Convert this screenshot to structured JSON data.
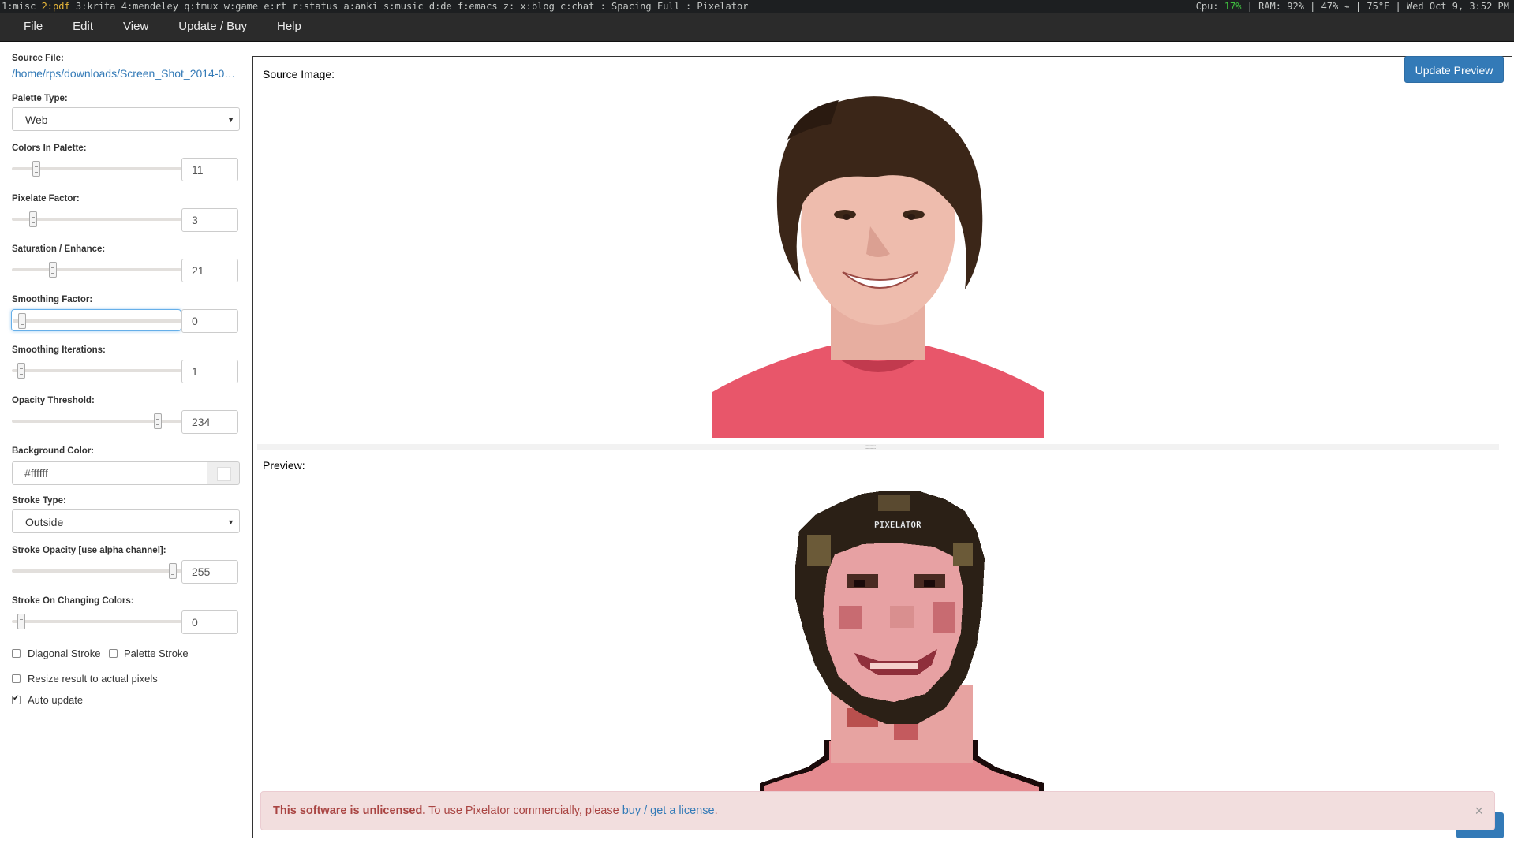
{
  "statusbar": {
    "ws_before": "1:misc ",
    "ws_active": "2:pdf",
    "ws_after": " 3:krita 4:mendeley q:tmux w:game e:rt r:status a:anki s:music d:de f:emacs z: x:blog c:chat : Spacing Full : Pixelator",
    "cpu_label": "Cpu: ",
    "cpu_value": "17%",
    "rest": " | RAM: 92% | 47% ⌁ | 75°F | Wed Oct  9,  3:52 PM"
  },
  "menu": {
    "items": [
      "File",
      "Edit",
      "View",
      "Update / Buy",
      "Help"
    ]
  },
  "sidebar": {
    "source_file_label": "Source File:",
    "source_file_path": "/home/rps/downloads/Screen_Shot_2014-05-…",
    "palette_type_label": "Palette Type:",
    "palette_type_value": "Web",
    "colors_label": "Colors In Palette:",
    "colors_value": "11",
    "colors_level": 0.1,
    "pixelate_label": "Pixelate Factor:",
    "pixelate_value": "3",
    "pixelate_level": 0.08,
    "saturation_label": "Saturation / Enhance:",
    "saturation_value": "21",
    "saturation_level": 0.21,
    "smoothing_label": "Smoothing Factor:",
    "smoothing_value": "0",
    "smoothing_level": 0.0,
    "iterations_label": "Smoothing Iterations:",
    "iterations_value": "1",
    "iterations_level": 0.0,
    "opacity_label": "Opacity Threshold:",
    "opacity_value": "234",
    "opacity_level": 0.9,
    "bg_color_label": "Background Color:",
    "bg_color_value": "#ffffff",
    "stroke_type_label": "Stroke Type:",
    "stroke_type_value": "Outside",
    "stroke_opacity_label": "Stroke Opacity [use alpha channel]:",
    "stroke_opacity_value": "255",
    "stroke_opacity_level": 1.0,
    "stroke_changing_label": "Stroke On Changing Colors:",
    "stroke_changing_value": "0",
    "stroke_changing_level": 0.0,
    "diagonal_stroke_label": "Diagonal Stroke",
    "palette_stroke_label": "Palette Stroke",
    "resize_label": "Resize result to actual pixels",
    "auto_update_label": "Auto update"
  },
  "main": {
    "source_title": "Source Image:",
    "preview_title": "Preview:",
    "update_button": "Update Preview",
    "watermark": "PIXELATOR"
  },
  "alert": {
    "bold": "This software is unlicensed.",
    "text": " To use Pixelator commercially, please ",
    "link": "buy / get a license",
    "end": ".",
    "close": "×"
  },
  "colors": {
    "accent": "#337ab7",
    "alert_bg": "#f2dede",
    "alert_text": "#a94442",
    "shirt": "#e8566a",
    "hair": "#3b2618"
  }
}
